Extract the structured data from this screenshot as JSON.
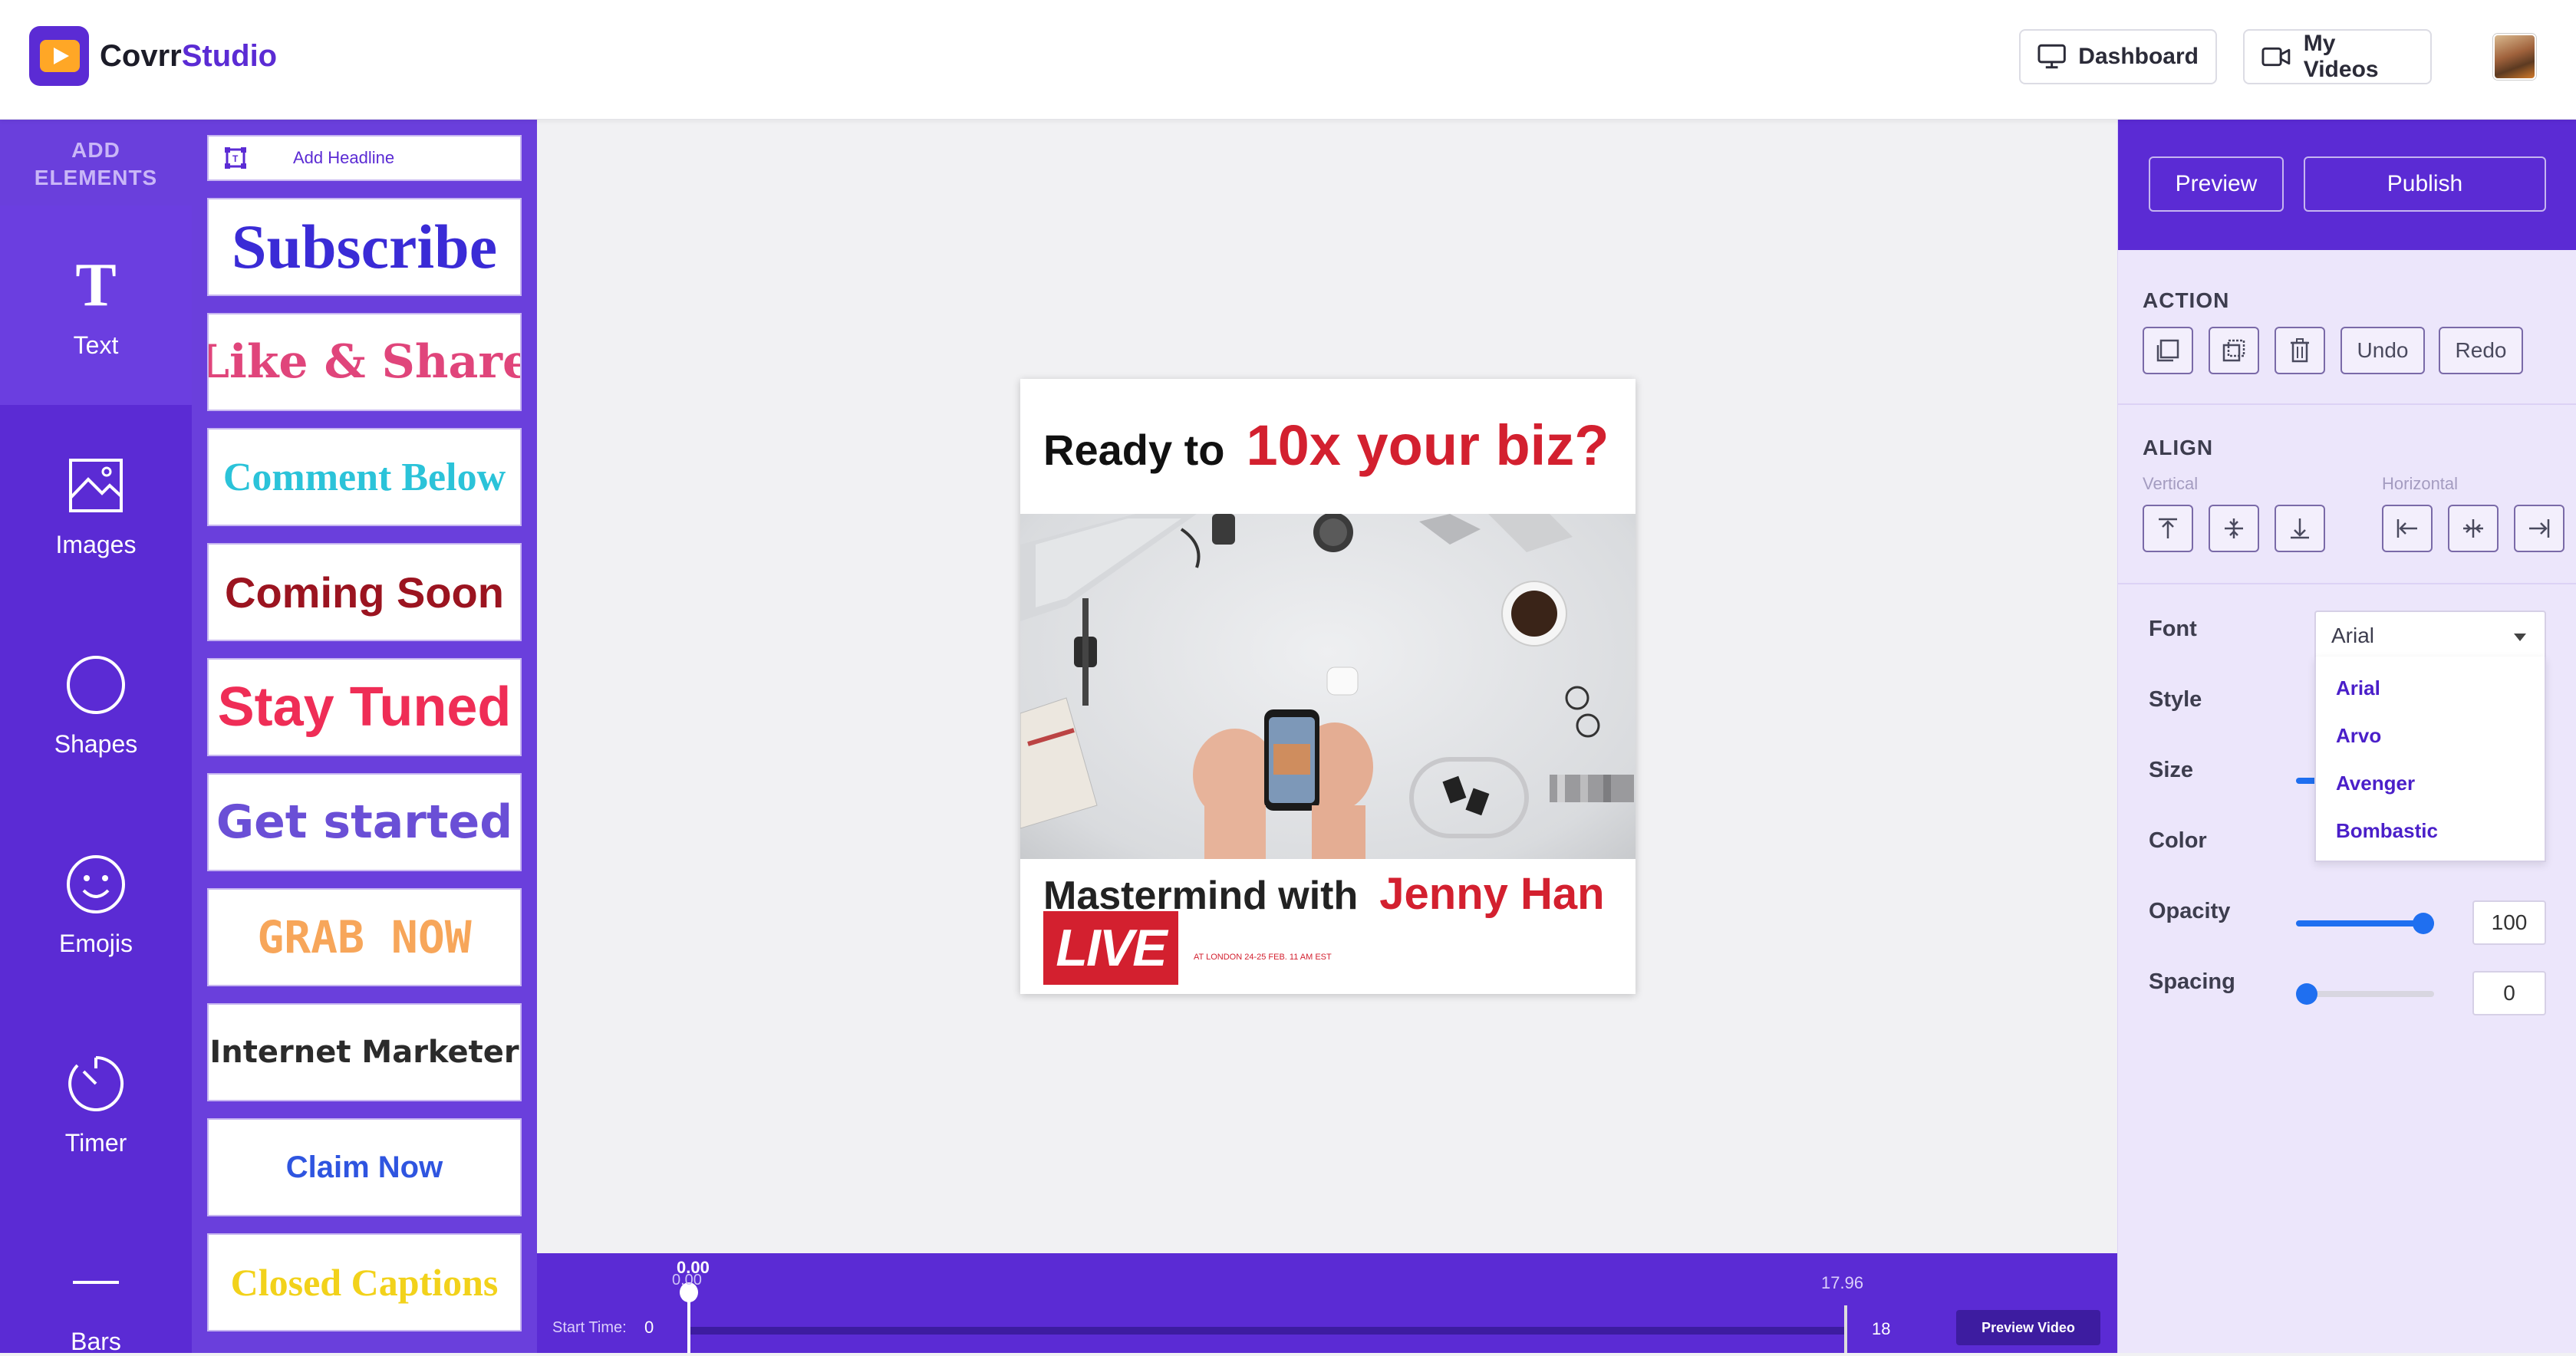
{
  "app": {
    "name_part1": "Covrr",
    "name_part2": "Studio"
  },
  "topbar": {
    "dashboard_label": "Dashboard",
    "my_videos_label": "My Videos"
  },
  "rail": {
    "title_line1": "ADD",
    "title_line2": "ELEMENTS",
    "items": [
      {
        "label": "Text",
        "icon": "text-icon"
      },
      {
        "label": "Images",
        "icon": "image-icon"
      },
      {
        "label": "Shapes",
        "icon": "circle-icon"
      },
      {
        "label": "Emojis",
        "icon": "smiley-icon"
      },
      {
        "label": "Timer",
        "icon": "timer-icon"
      },
      {
        "label": "Bars",
        "icon": "bar-icon"
      }
    ]
  },
  "elements": {
    "add_headline_label": "Add Headline",
    "presets": [
      {
        "text": "Subscribe",
        "color": "#3a2bd6"
      },
      {
        "text": "Like & Share",
        "color": "#e0457b"
      },
      {
        "text": "Comment Below",
        "color": "#2bc3d9"
      },
      {
        "text": "Coming Soon",
        "color": "#9b1420"
      },
      {
        "text": "Stay Tuned",
        "color": "#ef2d56"
      },
      {
        "text": "Get started",
        "color": "#6a4fd6"
      },
      {
        "text": "GRAB NOW",
        "color": "#f7a65a"
      },
      {
        "text": "Internet Marketer",
        "color": "#2b2b2b"
      },
      {
        "text": "Claim Now",
        "color": "#2f55e0"
      },
      {
        "text": "Closed Captions",
        "color": "#f2d21b"
      }
    ]
  },
  "artboard": {
    "headline_a": "Ready to",
    "headline_b": "10x your biz?",
    "mid_a": "Mastermind with",
    "mid_b": "Jenny Han",
    "live_label": "LIVE",
    "live_sub": "AT LONDON 24-25 FEB. 11 AM EST"
  },
  "timeline": {
    "start_label": "Start Time:",
    "start_value": "0",
    "current_a": "0.00",
    "current_b": "0.00",
    "end_top": "17.96",
    "end_value": "18",
    "preview_label": "Preview Video"
  },
  "panel": {
    "preview_label": "Preview",
    "publish_label": "Publish",
    "action_title": "ACTION",
    "undo_label": "Undo",
    "redo_label": "Redo",
    "align_title": "ALIGN",
    "vertical_label": "Vertical",
    "horizontal_label": "Horizontal",
    "font_label": "Font",
    "style_label": "Style",
    "size_label": "Size",
    "color_label": "Color",
    "opacity_label": "Opacity",
    "spacing_label": "Spacing",
    "font_value": "Arial",
    "font_options": [
      "Arial",
      "Arvo",
      "Avenger",
      "Bombastic"
    ],
    "opacity_value": "100",
    "opacity_level": 1.0,
    "spacing_value": "0",
    "spacing_level": 0.0
  },
  "colors": {
    "brand": "#5b2bd4",
    "accent_red": "#d3202f",
    "slider": "#1f6ff0"
  }
}
